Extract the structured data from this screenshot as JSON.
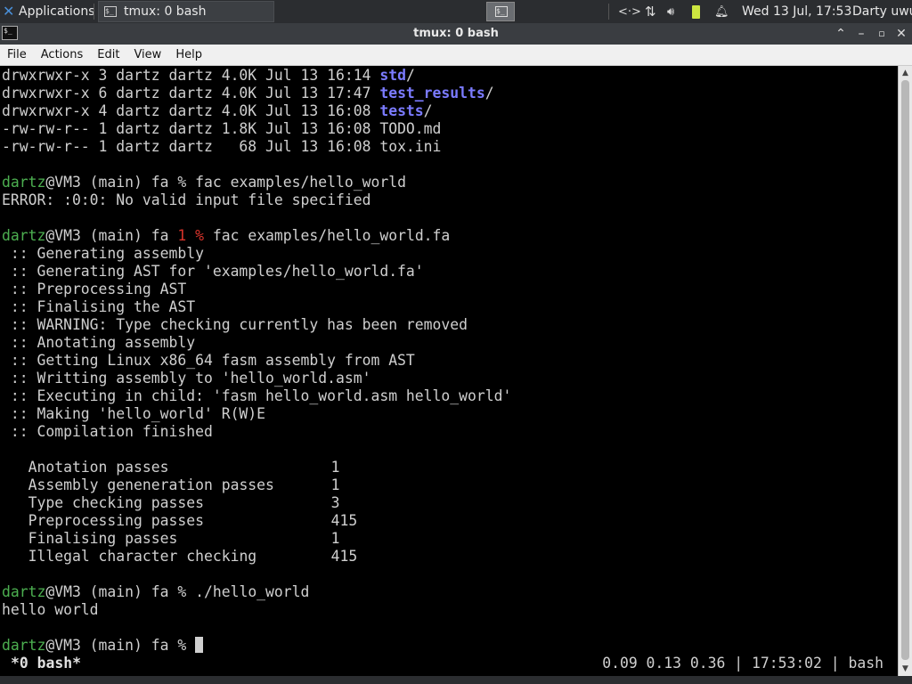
{
  "panel": {
    "apps_label": "Applications",
    "task_title": "tmux: 0 bash",
    "clock": "Wed 13 Jul, 17:53",
    "user": "Darty uwu"
  },
  "window": {
    "title": "tmux: 0 bash"
  },
  "menu": [
    "File",
    "Actions",
    "Edit",
    "View",
    "Help"
  ],
  "terminal": {
    "ls": [
      {
        "perm": "drwxrwxr-x 3 dartz dartz 4.0K Jul 13 16:14 ",
        "name": "std",
        "tail": "/",
        "dir": true
      },
      {
        "perm": "drwxrwxr-x 6 dartz dartz 4.0K Jul 13 17:47 ",
        "name": "test_results",
        "tail": "/",
        "dir": true
      },
      {
        "perm": "drwxrwxr-x 4 dartz dartz 4.0K Jul 13 16:08 ",
        "name": "tests",
        "tail": "/",
        "dir": true
      },
      {
        "perm": "-rw-rw-r-- 1 dartz dartz 1.8K Jul 13 16:08 ",
        "name": "TODO.md",
        "tail": "",
        "dir": false
      },
      {
        "perm": "-rw-rw-r-- 1 dartz dartz   68 Jul 13 16:08 ",
        "name": "tox.ini",
        "tail": "",
        "dir": false
      }
    ],
    "user": "dartz",
    "host": "@VM3 (main) fa ",
    "cmd1": "% fac examples/hello_world",
    "error1": "ERROR: :0:0: No valid input file specified",
    "status_code": "1 %",
    "cmd2": " fac examples/hello_world.fa",
    "steps": [
      " :: Generating assembly",
      " :: Generating AST for 'examples/hello_world.fa'",
      " :: Preprocessing AST",
      " :: Finalising the AST",
      " :: WARNING: Type checking currently has been removed",
      " :: Anotating assembly",
      " :: Getting Linux x86_64 fasm assembly from AST",
      " :: Writting assembly to 'hello_world.asm'",
      " :: Executing in child: 'fasm hello_world.asm hello_world'",
      " :: Making 'hello_world' R(W)E",
      " :: Compilation finished"
    ],
    "passes": [
      {
        "name": "Anotation passes",
        "count": "1"
      },
      {
        "name": "Assembly geneneration passes",
        "count": "1"
      },
      {
        "name": "Type checking passes",
        "count": "3"
      },
      {
        "name": "Preprocessing passes",
        "count": "415"
      },
      {
        "name": "Finalising passes",
        "count": "1"
      },
      {
        "name": "Illegal character checking",
        "count": "415"
      }
    ],
    "cmd3": "% ./hello_world",
    "output3": "hello world",
    "prompt_end": "% "
  },
  "tmux": {
    "window_label": "*0 bash*",
    "status_right": "0.09 0.13 0.36 | 17:53:02 | bash"
  }
}
